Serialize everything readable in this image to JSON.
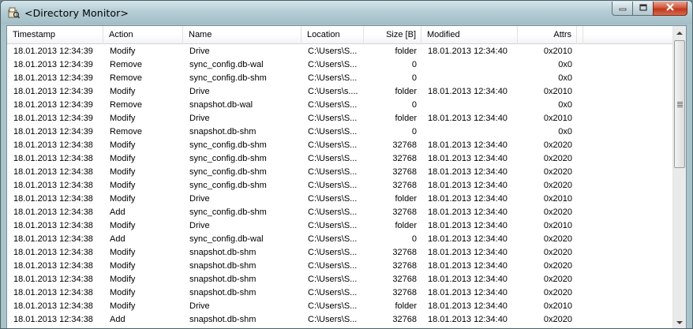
{
  "window": {
    "title": "<Directory Monitor>"
  },
  "columns": {
    "timestamp": "Timestamp",
    "action": "Action",
    "name": "Name",
    "location": "Location",
    "size": "Size [B]",
    "modified": "Modified",
    "attrs": "Attrs"
  },
  "rows": [
    {
      "ts": "18.01.2013 12:34:39",
      "action": "Modify",
      "name": "Drive",
      "loc": "C:\\Users\\S...",
      "size": "folder",
      "mod": "18.01.2013 12:34:40",
      "attrs": "0x2010"
    },
    {
      "ts": "18.01.2013 12:34:39",
      "action": "Remove",
      "name": "sync_config.db-wal",
      "loc": "C:\\Users\\S...",
      "size": "0",
      "mod": "",
      "attrs": "0x0"
    },
    {
      "ts": "18.01.2013 12:34:39",
      "action": "Remove",
      "name": "sync_config.db-shm",
      "loc": "C:\\Users\\S...",
      "size": "0",
      "mod": "",
      "attrs": "0x0"
    },
    {
      "ts": "18.01.2013 12:34:39",
      "action": "Modify",
      "name": "Drive",
      "loc": "C:\\Users\\s....",
      "size": "folder",
      "mod": "18.01.2013 12:34:40",
      "attrs": "0x2010"
    },
    {
      "ts": "18.01.2013 12:34:39",
      "action": "Remove",
      "name": "snapshot.db-wal",
      "loc": "C:\\Users\\S...",
      "size": "0",
      "mod": "",
      "attrs": "0x0"
    },
    {
      "ts": "18.01.2013 12:34:39",
      "action": "Modify",
      "name": "Drive",
      "loc": "C:\\Users\\S...",
      "size": "folder",
      "mod": "18.01.2013 12:34:40",
      "attrs": "0x2010"
    },
    {
      "ts": "18.01.2013 12:34:39",
      "action": "Remove",
      "name": "snapshot.db-shm",
      "loc": "C:\\Users\\S...",
      "size": "0",
      "mod": "",
      "attrs": "0x0"
    },
    {
      "ts": "18.01.2013 12:34:38",
      "action": "Modify",
      "name": "sync_config.db-shm",
      "loc": "C:\\Users\\S...",
      "size": "32768",
      "mod": "18.01.2013 12:34:40",
      "attrs": "0x2020"
    },
    {
      "ts": "18.01.2013 12:34:38",
      "action": "Modify",
      "name": "sync_config.db-shm",
      "loc": "C:\\Users\\S...",
      "size": "32768",
      "mod": "18.01.2013 12:34:40",
      "attrs": "0x2020"
    },
    {
      "ts": "18.01.2013 12:34:38",
      "action": "Modify",
      "name": "sync_config.db-shm",
      "loc": "C:\\Users\\S...",
      "size": "32768",
      "mod": "18.01.2013 12:34:40",
      "attrs": "0x2020"
    },
    {
      "ts": "18.01.2013 12:34:38",
      "action": "Modify",
      "name": "sync_config.db-shm",
      "loc": "C:\\Users\\S...",
      "size": "32768",
      "mod": "18.01.2013 12:34:40",
      "attrs": "0x2020"
    },
    {
      "ts": "18.01.2013 12:34:38",
      "action": "Modify",
      "name": "Drive",
      "loc": "C:\\Users\\S...",
      "size": "folder",
      "mod": "18.01.2013 12:34:40",
      "attrs": "0x2010"
    },
    {
      "ts": "18.01.2013 12:34:38",
      "action": "Add",
      "name": "sync_config.db-shm",
      "loc": "C:\\Users\\S...",
      "size": "32768",
      "mod": "18.01.2013 12:34:40",
      "attrs": "0x2020"
    },
    {
      "ts": "18.01.2013 12:34:38",
      "action": "Modify",
      "name": "Drive",
      "loc": "C:\\Users\\S...",
      "size": "folder",
      "mod": "18.01.2013 12:34:40",
      "attrs": "0x2010"
    },
    {
      "ts": "18.01.2013 12:34:38",
      "action": "Add",
      "name": "sync_config.db-wal",
      "loc": "C:\\Users\\S...",
      "size": "0",
      "mod": "18.01.2013 12:34:40",
      "attrs": "0x2020"
    },
    {
      "ts": "18.01.2013 12:34:38",
      "action": "Modify",
      "name": "snapshot.db-shm",
      "loc": "C:\\Users\\S...",
      "size": "32768",
      "mod": "18.01.2013 12:34:40",
      "attrs": "0x2020"
    },
    {
      "ts": "18.01.2013 12:34:38",
      "action": "Modify",
      "name": "snapshot.db-shm",
      "loc": "C:\\Users\\S...",
      "size": "32768",
      "mod": "18.01.2013 12:34:40",
      "attrs": "0x2020"
    },
    {
      "ts": "18.01.2013 12:34:38",
      "action": "Modify",
      "name": "snapshot.db-shm",
      "loc": "C:\\Users\\S...",
      "size": "32768",
      "mod": "18.01.2013 12:34:40",
      "attrs": "0x2020"
    },
    {
      "ts": "18.01.2013 12:34:38",
      "action": "Modify",
      "name": "snapshot.db-shm",
      "loc": "C:\\Users\\S...",
      "size": "32768",
      "mod": "18.01.2013 12:34:40",
      "attrs": "0x2020"
    },
    {
      "ts": "18.01.2013 12:34:38",
      "action": "Modify",
      "name": "Drive",
      "loc": "C:\\Users\\S...",
      "size": "folder",
      "mod": "18.01.2013 12:34:40",
      "attrs": "0x2010"
    },
    {
      "ts": "18.01.2013 12:34:38",
      "action": "Add",
      "name": "snapshot.db-shm",
      "loc": "C:\\Users\\S...",
      "size": "32768",
      "mod": "18.01.2013 12:34:40",
      "attrs": "0x2020"
    }
  ],
  "icons": {
    "app": "app-icon",
    "minimize": "minimize-icon",
    "maximize": "maximize-icon",
    "close": "close-icon",
    "scroll_up": "scroll-up-icon",
    "scroll_down": "scroll-down-icon"
  }
}
